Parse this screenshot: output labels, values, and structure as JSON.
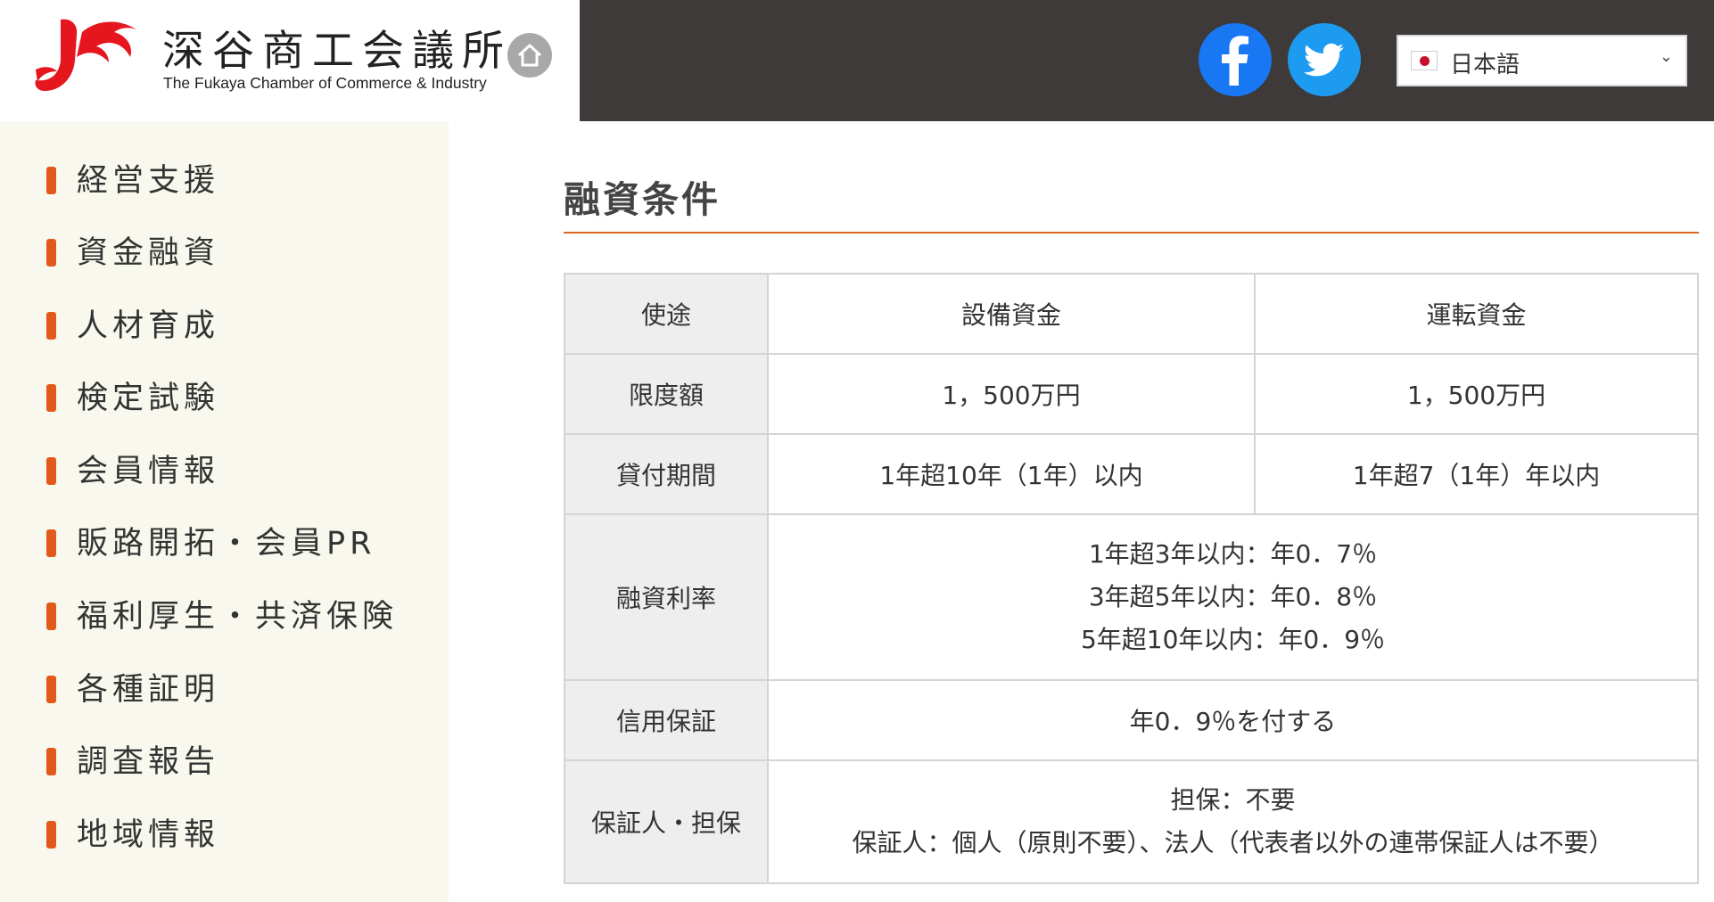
{
  "header": {
    "logo_title": "深谷商工会議所",
    "logo_subtitle": "The Fukaya Chamber of Commerce & Industry",
    "home_icon": "home-icon",
    "social": [
      {
        "name": "facebook-icon",
        "color": "#1877f2"
      },
      {
        "name": "twitter-icon",
        "color": "#1d9bf0"
      }
    ],
    "language": {
      "selected": "日本語",
      "flag": "japan-flag-icon"
    }
  },
  "colors": {
    "accent": "#e25a19",
    "header_dark": "#3d3a39",
    "sidebar_bg": "#f9f8ee",
    "table_header_bg": "#eeeeee"
  },
  "sidebar": {
    "items": [
      {
        "label": "経営支援"
      },
      {
        "label": "資金融資"
      },
      {
        "label": "人材育成"
      },
      {
        "label": "検定試験"
      },
      {
        "label": "会員情報"
      },
      {
        "label": "販路開拓・会員PR"
      },
      {
        "label": "福利厚生・共済保険"
      },
      {
        "label": "各種証明"
      },
      {
        "label": "調査報告"
      },
      {
        "label": "地域情報"
      }
    ]
  },
  "main": {
    "title": "融資条件",
    "table": {
      "usage": {
        "label": "使途",
        "equipment": "設備資金",
        "operating": "運転資金"
      },
      "limit": {
        "label": "限度額",
        "equipment": "1，500万円",
        "operating": "1，500万円"
      },
      "period": {
        "label": "貸付期間",
        "equipment": "1年超10年（1年）以内",
        "operating": "1年超7（1年）年以内"
      },
      "rate": {
        "label": "融資利率",
        "lines": [
          "1年超3年以内：年0．7％",
          "3年超5年以内：年0．8％",
          "5年超10年以内：年0．9％"
        ]
      },
      "credit": {
        "label": "信用保証",
        "value": "年0．9％を付する"
      },
      "guarantor": {
        "label": "保証人・担保",
        "lines": [
          "担保：不要",
          "保証人：個人（原則不要）、法人（代表者以外の連帯保証人は不要）"
        ]
      }
    }
  }
}
